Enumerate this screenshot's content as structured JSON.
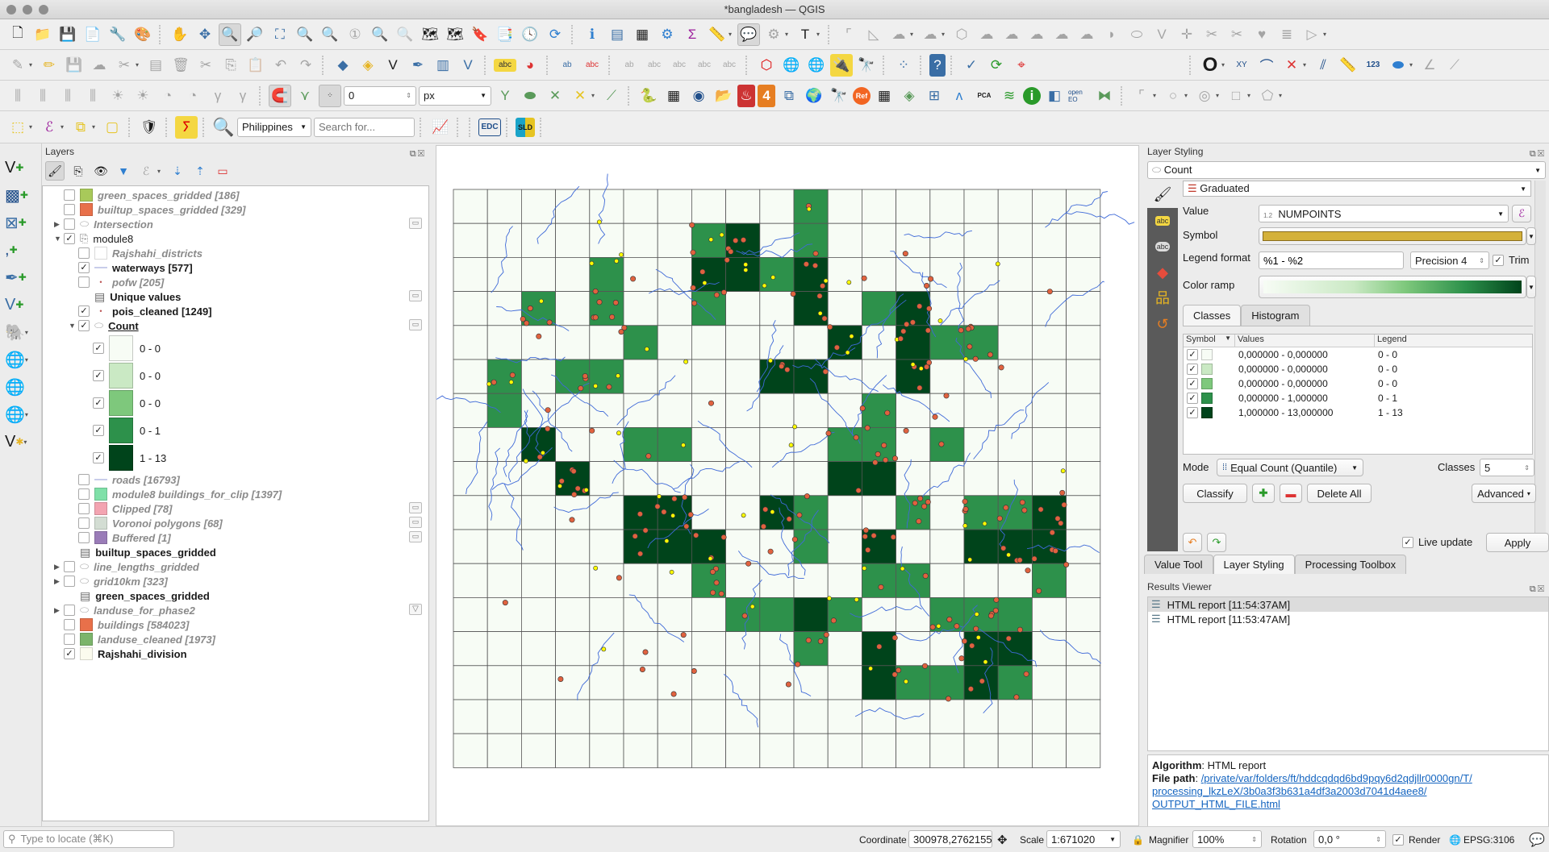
{
  "window": {
    "title": "*bangladesh — QGIS"
  },
  "toolbars": {
    "row1": [
      "new-project",
      "open-project",
      "save-project",
      "new-print-layout",
      "show-layout-manager",
      "style-manager",
      "pan",
      "pan-to-selection",
      "zoom-in",
      "zoom-out",
      "zoom-full",
      "zoom-to-selection",
      "zoom-to-layer",
      "zoom-native",
      "zoom-last",
      "zoom-next",
      "new-map-view",
      "new-3d-map-view",
      "new-bookmark",
      "show-bookmarks",
      "temporal-controller",
      "refresh",
      "identify",
      "open-attribute-table",
      "statistical-summary",
      "processing-toolbox",
      "field-calculator",
      "measure",
      "map-tips",
      "select-by-location",
      "text-annotation",
      "digitize-shape",
      "measure-angle",
      "add-ring",
      "add-part",
      "fill-ring",
      "delete-ring",
      "delete-part",
      "reshape",
      "offset-curve",
      "split-features",
      "split-parts",
      "merge-features",
      "merge-attributes",
      "rotate-point-symbols",
      "offset-point-symbols"
    ],
    "row2_labels": {
      "snap_tolerance": "0",
      "snap_units": "px"
    },
    "locator": {
      "country": "Philippines",
      "search_placeholder": "Search for..."
    },
    "row3_badges": {
      "pca": "PCA",
      "openeo": "open EO",
      "edc": "EDC",
      "cadtools_label": "123",
      "xy_label": "XY"
    }
  },
  "layers_panel": {
    "title": "Layers",
    "items": [
      {
        "name": "green_spaces_gridded [186]",
        "style": "italic",
        "checked": false,
        "swatch": "#a8c95a",
        "indent": 1
      },
      {
        "name": "builtup_spaces_gridded [329]",
        "style": "italic",
        "checked": false,
        "swatch": "#e8704a",
        "indent": 1
      },
      {
        "name": "Intersection",
        "style": "italic",
        "checked": false,
        "icon": "polygon",
        "indent": 1,
        "expander": "collapsed",
        "badge": true
      },
      {
        "name": "module8",
        "style": "normal",
        "checked": true,
        "icon": "group",
        "indent": 1,
        "expander": "expanded"
      },
      {
        "name": "Rajshahi_districts",
        "style": "italic",
        "checked": false,
        "swatch": "#ffffff",
        "indent": 2
      },
      {
        "name": "waterways [577]",
        "style": "bold",
        "checked": true,
        "icon": "line",
        "indent": 2
      },
      {
        "name": "pofw [205]",
        "style": "italic",
        "checked": false,
        "icon": "point",
        "indent": 2
      },
      {
        "name": "Unique values",
        "style": "bold",
        "icon": "table",
        "indent": 2,
        "badge": true
      },
      {
        "name": "pois_cleaned [1249]",
        "style": "bold",
        "checked": true,
        "icon": "point",
        "indent": 2
      },
      {
        "name": "Count",
        "style": "bold-underline",
        "checked": true,
        "icon": "polygon",
        "indent": 2,
        "expander": "expanded",
        "badge": true
      }
    ],
    "count_legend": [
      {
        "label": "0 - 0",
        "color": "#f7fcf5",
        "checked": true
      },
      {
        "label": "0 - 0",
        "color": "#cae9c4",
        "checked": true
      },
      {
        "label": "0 - 0",
        "color": "#7ec87c",
        "checked": true
      },
      {
        "label": "0 - 1",
        "color": "#2d914b",
        "checked": true
      },
      {
        "label": "1 - 13",
        "color": "#00441b",
        "checked": true
      }
    ],
    "items_after": [
      {
        "name": "roads [16793]",
        "style": "italic",
        "checked": false,
        "icon": "line",
        "indent": 2
      },
      {
        "name": "module8 buildings_for_clip [1397]",
        "style": "italic",
        "checked": false,
        "swatch": "#7fe0a8",
        "indent": 2
      },
      {
        "name": "Clipped [78]",
        "style": "italic",
        "checked": false,
        "swatch": "#f3a4b1",
        "indent": 2,
        "badge": true
      },
      {
        "name": "Voronoi polygons [68]",
        "style": "italic",
        "checked": false,
        "swatch": "#d3ddd3",
        "indent": 2,
        "badge": true
      },
      {
        "name": "Buffered [1]",
        "style": "italic",
        "checked": false,
        "swatch": "#9a7cb8",
        "indent": 2,
        "badge": true
      },
      {
        "name": "builtup_spaces_gridded",
        "style": "bold",
        "icon": "table",
        "indent": 1
      },
      {
        "name": "line_lengths_gridded",
        "style": "italic",
        "checked": false,
        "icon": "polygon",
        "indent": 1,
        "expander": "collapsed"
      },
      {
        "name": "grid10km [323]",
        "style": "italic",
        "checked": false,
        "icon": "polygon",
        "indent": 1,
        "expander": "collapsed"
      },
      {
        "name": "green_spaces_gridded",
        "style": "bold",
        "icon": "table",
        "indent": 1
      },
      {
        "name": "landuse_for_phase2",
        "style": "italic",
        "checked": false,
        "icon": "polygon",
        "indent": 1,
        "expander": "collapsed",
        "filter": true
      },
      {
        "name": "buildings [584023]",
        "style": "italic",
        "checked": false,
        "swatch": "#e8704a",
        "indent": 1
      },
      {
        "name": "landuse_cleaned [1973]",
        "style": "italic",
        "checked": false,
        "swatch": "#7cb46b",
        "indent": 1
      },
      {
        "name": "Rajshahi_division",
        "style": "bold",
        "checked": true,
        "swatch": "#fbfbee",
        "indent": 0
      }
    ]
  },
  "map": {
    "grid_cols": 19,
    "grid_rows": 17,
    "colors": {
      "empty": "#f7fcf5",
      "mid": "#2d914b",
      "dark": "#00441b",
      "grid_line": "#555555",
      "water": "#3f6ad8",
      "poi": "#e0623f",
      "pofw": "#ffff00"
    },
    "mid_cells": [
      [
        0,
        10
      ],
      [
        1,
        7
      ],
      [
        1,
        10
      ],
      [
        2,
        4
      ],
      [
        2,
        9
      ],
      [
        3,
        2
      ],
      [
        3,
        4
      ],
      [
        3,
        7
      ],
      [
        3,
        12
      ],
      [
        4,
        5
      ],
      [
        4,
        14
      ],
      [
        4,
        15
      ],
      [
        5,
        1
      ],
      [
        5,
        3
      ],
      [
        5,
        4
      ],
      [
        6,
        1
      ],
      [
        6,
        12
      ],
      [
        7,
        5
      ],
      [
        7,
        6
      ],
      [
        7,
        11
      ],
      [
        7,
        12
      ],
      [
        7,
        14
      ],
      [
        9,
        10
      ],
      [
        9,
        13
      ],
      [
        9,
        15
      ],
      [
        9,
        16
      ],
      [
        10,
        10
      ],
      [
        11,
        7
      ],
      [
        11,
        12
      ],
      [
        11,
        13
      ],
      [
        11,
        17
      ],
      [
        12,
        8
      ],
      [
        12,
        9
      ],
      [
        12,
        11
      ],
      [
        12,
        14
      ],
      [
        12,
        15
      ],
      [
        12,
        16
      ],
      [
        13,
        10
      ],
      [
        14,
        13
      ],
      [
        14,
        14
      ],
      [
        14,
        16
      ]
    ],
    "dark_cells": [
      [
        1,
        8
      ],
      [
        2,
        7
      ],
      [
        2,
        8
      ],
      [
        2,
        10
      ],
      [
        3,
        10
      ],
      [
        3,
        13
      ],
      [
        4,
        11
      ],
      [
        4,
        13
      ],
      [
        5,
        9
      ],
      [
        5,
        10
      ],
      [
        5,
        13
      ],
      [
        7,
        2
      ],
      [
        8,
        3
      ],
      [
        8,
        11
      ],
      [
        8,
        12
      ],
      [
        9,
        5
      ],
      [
        9,
        6
      ],
      [
        9,
        9
      ],
      [
        9,
        17
      ],
      [
        10,
        5
      ],
      [
        10,
        6
      ],
      [
        10,
        7
      ],
      [
        10,
        12
      ],
      [
        10,
        15
      ],
      [
        10,
        16
      ],
      [
        10,
        17
      ],
      [
        12,
        10
      ],
      [
        13,
        12
      ],
      [
        13,
        15
      ],
      [
        13,
        16
      ],
      [
        14,
        12
      ],
      [
        14,
        15
      ]
    ]
  },
  "layer_styling": {
    "title": "Layer Styling",
    "layer": "Count",
    "renderer": "Graduated",
    "value_label": "Value",
    "value_type": "1.2",
    "value": "NUMPOINTS",
    "symbol_label": "Symbol",
    "symbol_color": "#d4b13a",
    "legend_format_label": "Legend format",
    "legend_format": "%1 - %2",
    "precision": "Precision 4",
    "trim_label": "Trim",
    "trim_checked": true,
    "color_ramp_label": "Color ramp",
    "tabs": [
      "Classes",
      "Histogram"
    ],
    "columns": [
      "Symbol",
      "Values",
      "Legend"
    ],
    "classes": [
      {
        "color": "#f7fcf5",
        "values": "0,000000 - 0,000000",
        "legend": "0 - 0"
      },
      {
        "color": "#cae9c4",
        "values": "0,000000 - 0,000000",
        "legend": "0 - 0"
      },
      {
        "color": "#7ec87c",
        "values": "0,000000 - 0,000000",
        "legend": "0 - 0"
      },
      {
        "color": "#2d914b",
        "values": "0,000000 - 1,000000",
        "legend": "0 - 1"
      },
      {
        "color": "#00441b",
        "values": "1,000000 - 13,000000",
        "legend": "1 - 13"
      }
    ],
    "mode_label": "Mode",
    "mode": "Equal Count (Quantile)",
    "classes_label": "Classes",
    "classes_count": "5",
    "classify": "Classify",
    "delete_all": "Delete All",
    "advanced": "Advanced",
    "live_update": "Live update",
    "apply": "Apply"
  },
  "dock_tabs": [
    "Value Tool",
    "Layer Styling",
    "Processing Toolbox"
  ],
  "results_viewer": {
    "title": "Results Viewer",
    "items": [
      "HTML report [11:54:37AM]",
      "HTML report [11:53:47AM]"
    ],
    "algorithm_label": "Algorithm",
    "algorithm": "HTML report",
    "file_path_label": "File path",
    "file_path_lines": [
      "/private/var/folders/ft/hddcqdqd6bd9pqy6d2qdjllr0000gn/T/",
      "processing_lkzLeX/3b0a3f3b631a4df3a2003d7041d4aee8/",
      "OUTPUT_HTML_FILE.html"
    ]
  },
  "status": {
    "locate_placeholder": "Type to locate (⌘K)",
    "coordinate_label": "Coordinate",
    "coordinate": "300978,2762155",
    "scale_label": "Scale",
    "scale": "1:671020",
    "magnifier_label": "Magnifier",
    "magnifier": "100%",
    "rotation_label": "Rotation",
    "rotation": "0,0 °",
    "render_label": "Render",
    "crs": "EPSG:3106"
  }
}
